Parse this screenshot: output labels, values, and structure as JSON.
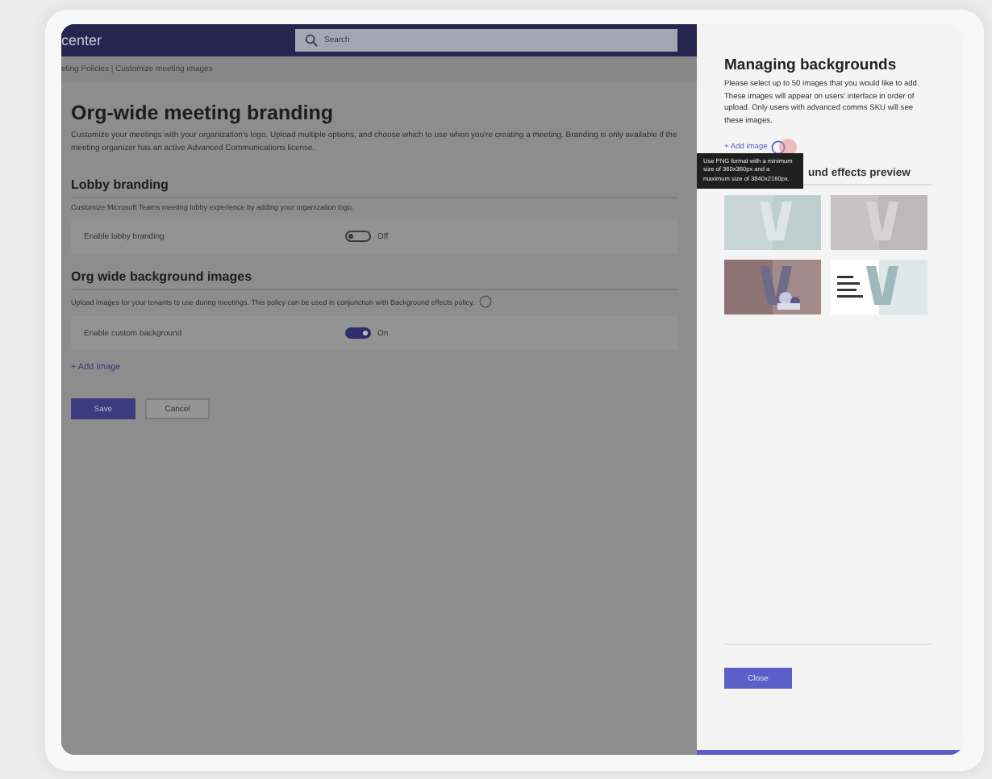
{
  "header": {
    "app_title": "center",
    "search": {
      "placeholder": "Search"
    }
  },
  "breadcrumb": "eting Policies | Customize meeting images",
  "page": {
    "title": "Org-wide meeting branding",
    "description": "Customize your meetings with your organization's logo. Upload multiple options, and choose which to use when you're creating a meeting. Branding is only available if the meeting organizer has an active Advanced Communications license.",
    "sections": [
      {
        "heading": "Lobby branding",
        "description": "Customize Microsoft Teams meeting lobby experience by adding your organization logo.",
        "info": false,
        "setting": {
          "label": "Enable lobby branding",
          "on": false,
          "state_text": "Off"
        }
      },
      {
        "heading": "Org wide background images",
        "description": "Upload images for your tenants to use during meetings. This policy can be used in conjunction with Background effects policy.",
        "info": true,
        "setting": {
          "label": "Enable custom background",
          "on": true,
          "state_text": "On"
        },
        "add_link": "+ Add image"
      }
    ],
    "buttons": [
      {
        "label": "Save",
        "kind": "primary"
      },
      {
        "label": "Cancel",
        "kind": "secondary"
      }
    ]
  },
  "panel": {
    "title": "Managing backgrounds",
    "description": "Please select up to 50 images that you would like to add. These images will appear on users' interface in order of upload. Only users with advanced comms SKU will see these images.",
    "add_link": "+ Add image",
    "tooltip": "Use PNG format with a minimum size of 360x360px and a maximum size of 3840x2160px.",
    "preview_heading": "und effects preview",
    "close_button": "Close"
  }
}
